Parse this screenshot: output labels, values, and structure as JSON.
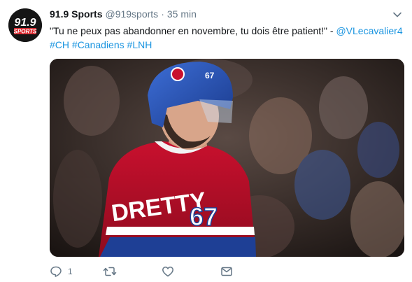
{
  "tweet": {
    "author_name": "91.9 Sports",
    "author_handle": "@919sports",
    "separator": "·",
    "timestamp": "35 min",
    "text_quote": "\"Tu ne peux pas abandonner en novembre, tu dois être patient!\" - ",
    "mention": "@VLecavalier4",
    "hashtags": [
      "#CH",
      "#Canadiens",
      "#LNH"
    ],
    "avatar": {
      "line1": "91.9",
      "line2": "SPORTS"
    },
    "media": {
      "jersey_name": "DRETTY",
      "jersey_number": "67",
      "helmet_number": "67"
    }
  },
  "actions": {
    "reply_count": "1",
    "retweet_count": "",
    "like_count": ""
  },
  "colors": {
    "link": "#1b95e0",
    "muted": "#657786",
    "text": "#14171a"
  }
}
